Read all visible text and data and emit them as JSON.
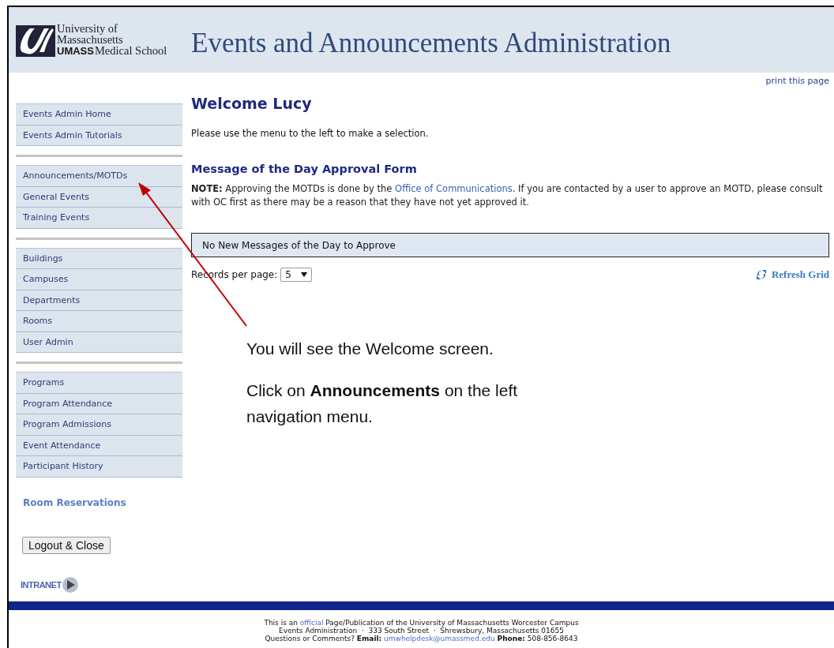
{
  "header": {
    "logo": {
      "line_1": "University of",
      "line_2": "Massachusetts",
      "mark": "UMASS",
      "line_3": "Medical School"
    },
    "title": "Events and Announcements Administration"
  },
  "print_link": "print this page",
  "sidebar": {
    "groups": [
      {
        "items": [
          {
            "label": "Events Admin Home"
          },
          {
            "label": "Events Admin Tutorials"
          }
        ]
      },
      {
        "items": [
          {
            "label": "Announcements/MOTDs"
          },
          {
            "label": "General Events"
          },
          {
            "label": "Training Events"
          }
        ]
      },
      {
        "items": [
          {
            "label": "Buildings"
          },
          {
            "label": "Campuses"
          },
          {
            "label": "Departments"
          },
          {
            "label": "Rooms"
          },
          {
            "label": "User Admin"
          }
        ]
      },
      {
        "items": [
          {
            "label": "Programs"
          },
          {
            "label": "Program Attendance"
          },
          {
            "label": "Program Admissions"
          },
          {
            "label": "Event Attendance"
          },
          {
            "label": "Participant History"
          }
        ]
      }
    ],
    "room_reservations": "Room Reservations",
    "logout_button": "Logout & Close",
    "intranet": "INTRANET"
  },
  "main": {
    "welcome": "Welcome Lucy",
    "intro": "Please use the menu to the left to make a selection.",
    "form_title": "Message of the Day Approval Form",
    "note": {
      "before": "**NOTE:** Approving the MOTDs is done by the ",
      "link": "Office of Communications",
      "after": ". If you are contacted by a user to approve an MOTD, please consult with OC first as there may be a reason that they have not yet approved it."
    },
    "grid_message": "No New Messages of the Day to Approve",
    "records_label": "Records per page:",
    "records_value": "5",
    "refresh": "Refresh Grid"
  },
  "footer": {
    "line_1": {
      "before": "This is an ",
      "link": "official",
      "after": " Page/Publication of the University of Massachusetts Worcester Campus"
    },
    "line_2": "Events Administration  ·  333 South Street  ·  Shrewsbury, Massachusetts 01655",
    "line_3": {
      "before": "Questions or Comments? **Email:** ",
      "link": "umwhelpdesk@umassmed.edu",
      "after": " **Phone:** 508-856-8643"
    }
  },
  "callout": {
    "line_1": "You will see the Welcome screen.",
    "line_2": "Click on **Announcements** on the left navigation menu."
  }
}
